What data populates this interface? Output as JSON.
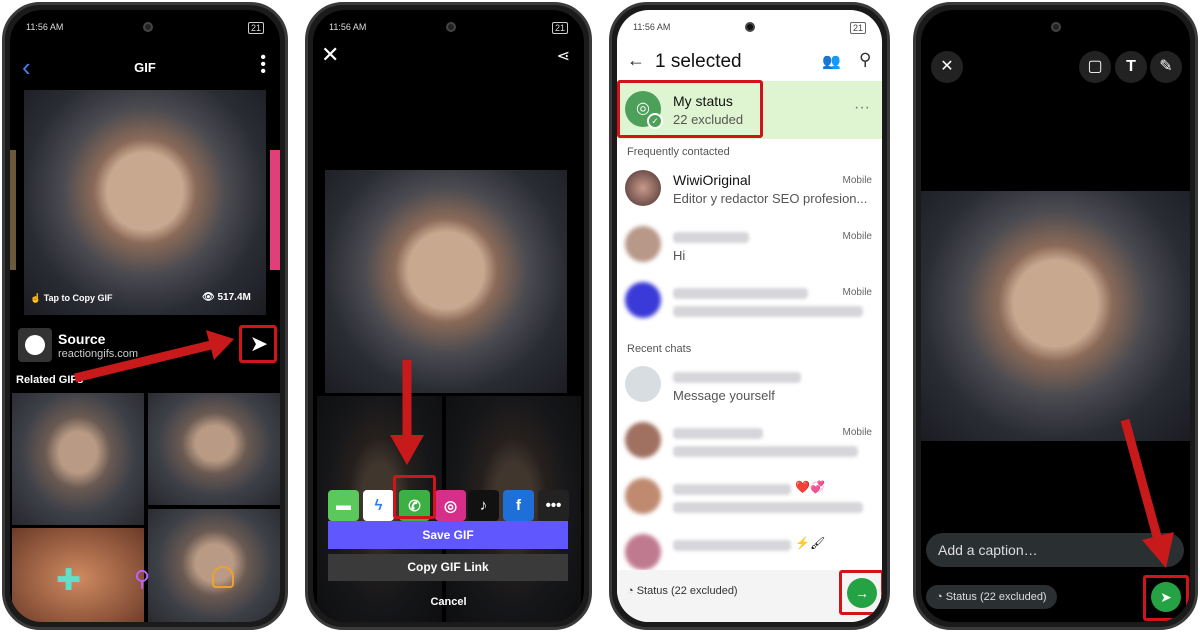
{
  "status_bar": {
    "time": "11:56 AM",
    "battery": "21"
  },
  "panel1": {
    "title": "GIF",
    "tap_hint": "Tap to Copy GIF",
    "views": "517.4M",
    "source_label": "Source",
    "source_domain": "reactiongifs.com",
    "related_label": "Related GIFs"
  },
  "panel2": {
    "save_label": "Save GIF",
    "copy_link_label": "Copy GIF Link",
    "cancel_label": "Cancel",
    "share_apps": [
      "messages",
      "messenger",
      "whatsapp",
      "instagram",
      "tiktok",
      "facebook",
      "more"
    ]
  },
  "panel3": {
    "header_title": "1 selected",
    "my_status_title": "My status",
    "my_status_sub": "22 excluded",
    "frequent_label": "Frequently contacted",
    "recent_label": "Recent chats",
    "contacts": [
      {
        "name": "WiwiOriginal",
        "sub": "Editor y redactor SEO profesion...",
        "tag": "Mobile"
      },
      {
        "name": "",
        "sub": "Hi",
        "tag": "Mobile"
      },
      {
        "name": "",
        "sub": "",
        "tag": "Mobile"
      }
    ],
    "recent": [
      {
        "name": "",
        "sub": "Message yourself",
        "tag": ""
      },
      {
        "name": "",
        "sub": "",
        "tag": "Mobile"
      },
      {
        "name": "",
        "sub": "",
        "tag": "",
        "emoji": "❤️💞"
      },
      {
        "name": "",
        "sub": "",
        "tag": "",
        "emoji": "⚡🖌"
      }
    ],
    "footer_status": "Status (22 excluded)",
    "accent": "#25a244"
  },
  "panel4": {
    "caption_placeholder": "Add a caption…",
    "footer_status": "Status (22 excluded)"
  },
  "colors": {
    "highlight": "#d0141a",
    "whatsapp_green": "#25a244",
    "save_button": "#6157ff"
  }
}
